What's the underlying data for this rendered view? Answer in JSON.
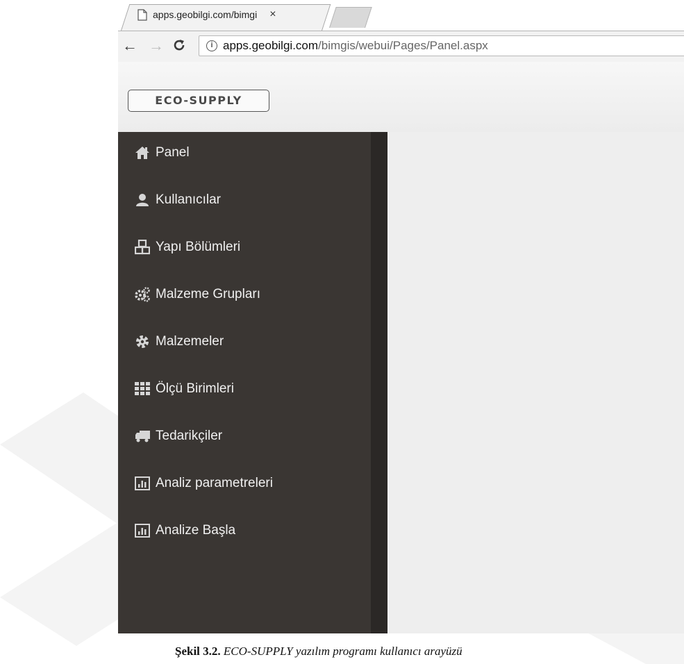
{
  "browser": {
    "tab_title": "apps.geobilgi.com/bimgi",
    "tab_close": "×",
    "url_host": "apps.geobilgi.com",
    "url_path": "/bimgis/webui/Pages/Panel.aspx",
    "back_icon": "arrow-left-icon",
    "forward_icon": "arrow-right-icon",
    "reload_icon": "reload-icon",
    "info_icon": "info-icon"
  },
  "app": {
    "logo_text": "ECO-SUPPLY"
  },
  "sidebar": {
    "background": "#3a3633",
    "items": [
      {
        "label": "Panel",
        "icon": "home-icon"
      },
      {
        "label": "Kullanıcılar",
        "icon": "user-icon"
      },
      {
        "label": "Yapı Bölümleri",
        "icon": "cubes-icon"
      },
      {
        "label": "Malzeme Grupları",
        "icon": "cogs-icon"
      },
      {
        "label": "Malzemeler",
        "icon": "gear-icon"
      },
      {
        "label": "Ölçü Birimleri",
        "icon": "grid-icon"
      },
      {
        "label": "Tedarikçiler",
        "icon": "truck-icon"
      },
      {
        "label": "Analiz parametreleri",
        "icon": "bar-chart-icon"
      },
      {
        "label": "Analize Başla",
        "icon": "bar-chart-icon"
      }
    ]
  },
  "caption": {
    "label": "Şekil 3.2.",
    "text": "ECO-SUPPLY yazılım programı kullanıcı arayüzü"
  }
}
